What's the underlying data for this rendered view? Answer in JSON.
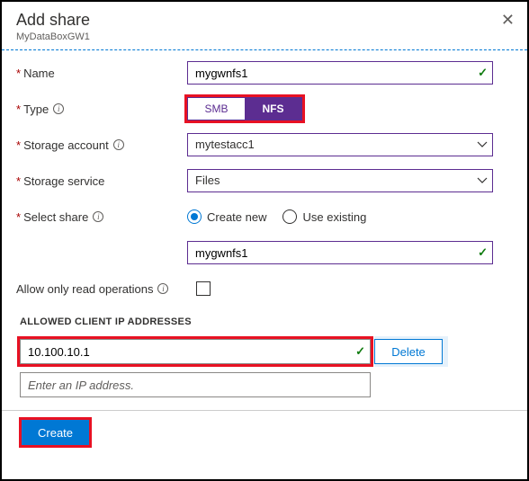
{
  "header": {
    "title": "Add share",
    "subtitle": "MyDataBoxGW1"
  },
  "form": {
    "name": {
      "label": "Name",
      "value": "mygwnfs1"
    },
    "type": {
      "label": "Type",
      "options": [
        "SMB",
        "NFS"
      ],
      "selected": "NFS"
    },
    "storage_account": {
      "label": "Storage account",
      "value": "mytestacc1"
    },
    "storage_service": {
      "label": "Storage service",
      "value": "Files"
    },
    "select_share": {
      "label": "Select share",
      "options": {
        "create": "Create new",
        "existing": "Use existing"
      },
      "value": "mygwnfs1"
    },
    "read_only": {
      "label": "Allow only read operations",
      "checked": false
    }
  },
  "ip_section": {
    "header": "ALLOWED CLIENT IP ADDRESSES",
    "entries": [
      "10.100.10.1"
    ],
    "placeholder": "Enter an IP address.",
    "delete_label": "Delete"
  },
  "footer": {
    "create_label": "Create"
  }
}
